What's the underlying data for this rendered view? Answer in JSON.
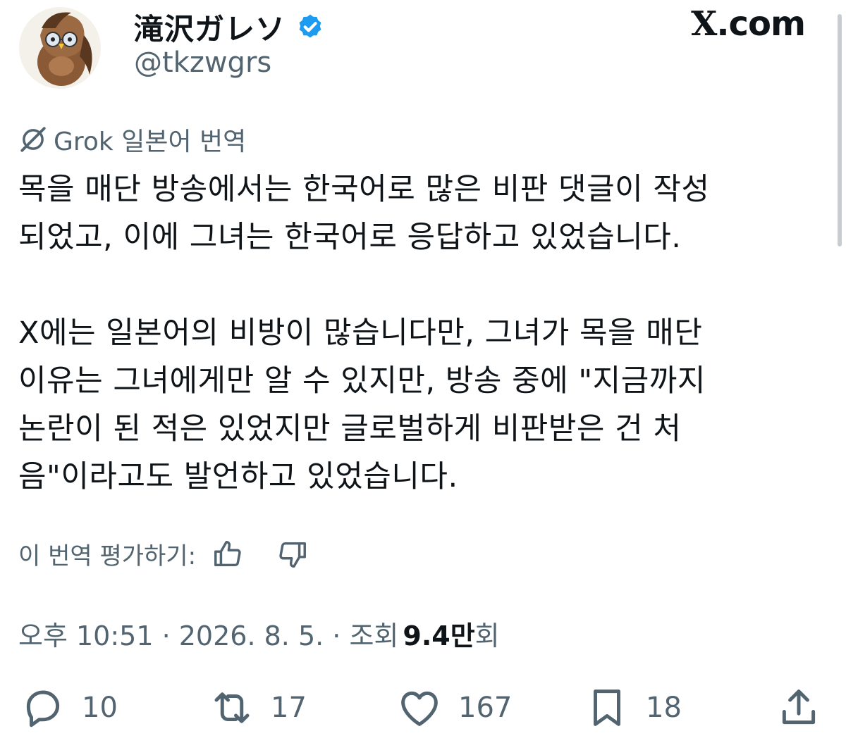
{
  "header": {
    "display_name": "滝沢ガレソ",
    "handle": "@tkzwgrs",
    "brand": {
      "x": "X",
      "domain": ".com"
    }
  },
  "translation": {
    "label": "Grok 일본어 번역"
  },
  "post": {
    "text": "목을 매단 방송에서는 한국어로 많은 비판 댓글이 작성\n되었고, 이에 그녀는 한국어로 응답하고 있었습니다.\n\nX에는 일본어의 비방이 많습니다만, 그녀가 목을 매단\n이유는 그녀에게만 알 수 있지만, 방송 중에 \"지금까지\n논란이 된 적은 있었지만 글로벌하게 비판받은 건 처\n음\"이라고도 발언하고 있었습니다."
  },
  "rating": {
    "label": "이 번역 평가하기:"
  },
  "meta": {
    "time": "오후 10:51 · 2026. 8. 5. · 조회",
    "views_number": "9.4만",
    "views_suffix": "회"
  },
  "actions": {
    "replies": "10",
    "reposts": "17",
    "likes": "167",
    "bookmarks": "18"
  },
  "colors": {
    "text": "#0f1419",
    "secondary": "#536471",
    "verified": "#1d9bf0"
  }
}
